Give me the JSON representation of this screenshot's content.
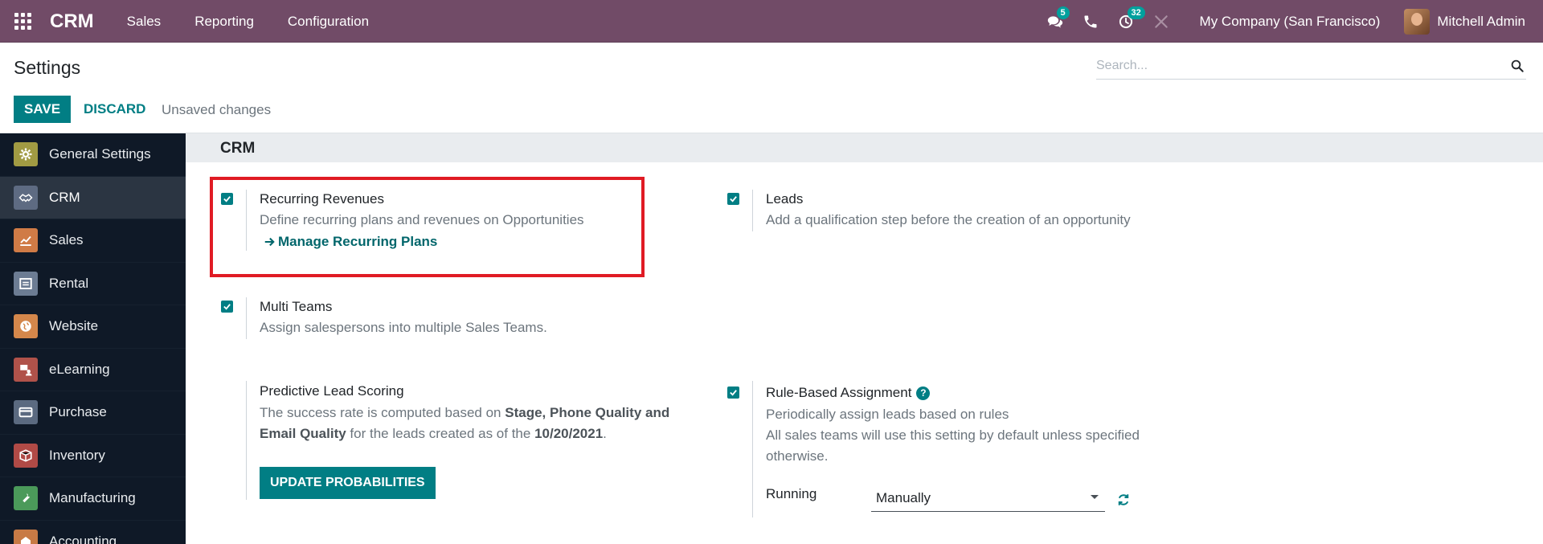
{
  "navbar": {
    "brand": "CRM",
    "menu": [
      "Sales",
      "Reporting",
      "Configuration"
    ],
    "messages_count": "5",
    "activities_count": "32",
    "company": "My Company (San Francisco)",
    "user": "Mitchell Admin"
  },
  "control_panel": {
    "title": "Settings",
    "search_placeholder": "Search...",
    "save_label": "SAVE",
    "discard_label": "DISCARD",
    "status": "Unsaved changes"
  },
  "sidebar": {
    "items": [
      {
        "label": "General Settings",
        "icon": "gear-icon",
        "color": "#a19b43"
      },
      {
        "label": "CRM",
        "icon": "handshake-icon",
        "color": "#5e6b82"
      },
      {
        "label": "Sales",
        "icon": "chart-icon",
        "color": "#d07b46"
      },
      {
        "label": "Rental",
        "icon": "rental-icon",
        "color": "#6c7c93"
      },
      {
        "label": "Website",
        "icon": "globe-icon",
        "color": "#d4874b"
      },
      {
        "label": "eLearning",
        "icon": "elearning-icon",
        "color": "#b0524a"
      },
      {
        "label": "Purchase",
        "icon": "card-icon",
        "color": "#5b6a80"
      },
      {
        "label": "Inventory",
        "icon": "box-icon",
        "color": "#b04a46"
      },
      {
        "label": "Manufacturing",
        "icon": "wrench-icon",
        "color": "#4b9a5a"
      },
      {
        "label": "Accounting",
        "icon": "accounting-icon",
        "color": "#c87a45"
      }
    ],
    "active": "CRM"
  },
  "section": {
    "title": "CRM"
  },
  "settings": {
    "recurring": {
      "title": "Recurring Revenues",
      "desc": "Define recurring plans and revenues on Opportunities",
      "link": "Manage Recurring Plans",
      "checked": true
    },
    "leads": {
      "title": "Leads",
      "desc": "Add a qualification step before the creation of an opportunity",
      "checked": true
    },
    "multi_teams": {
      "title": "Multi Teams",
      "desc": "Assign salespersons into multiple Sales Teams.",
      "checked": true
    },
    "predictive": {
      "title": "Predictive Lead Scoring",
      "desc_1": "The success rate is computed based on ",
      "desc_bold_1": "Stage, Phone Quality and Email Quality",
      "desc_2": " for the leads created as of the ",
      "desc_bold_2": "10/20/2021",
      "desc_3": ".",
      "button": "UPDATE PROBABILITIES"
    },
    "rule_based": {
      "title": "Rule-Based Assignment",
      "desc_1": "Periodically assign leads based on rules",
      "desc_2": "All sales teams will use this setting by default unless specified otherwise.",
      "running_label": "Running",
      "running_value": "Manually",
      "checked": true
    }
  },
  "colors": {
    "navbar": "#714b67",
    "accent": "#017e84",
    "highlight": "#e01b24"
  }
}
